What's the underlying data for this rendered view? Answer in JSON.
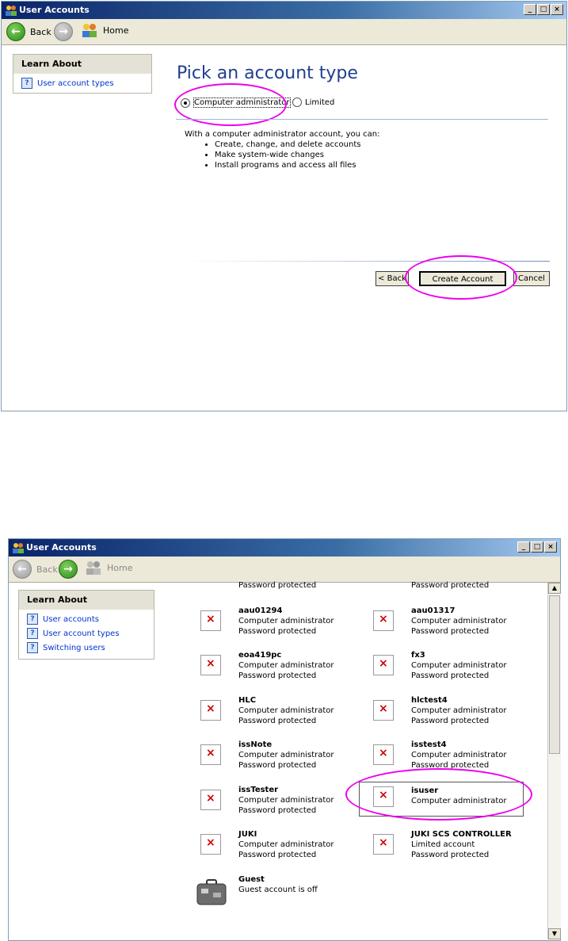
{
  "window1": {
    "title": "User Accounts",
    "back": "Back",
    "home": "Home",
    "learn_about": "Learn About",
    "learn_items": [
      "User account types"
    ],
    "heading": "Pick an account type",
    "radio_admin": "Computer administrator",
    "radio_limited": "Limited",
    "intro": "With a computer administrator account, you can:",
    "bullets": [
      "Create, change, and delete accounts",
      "Make system-wide changes",
      "Install programs and access all files"
    ],
    "back_btn": "< Back",
    "create_btn": "Create Account",
    "cancel_btn": "Cancel"
  },
  "window2": {
    "title": "User Accounts",
    "back": "Back",
    "home": "Home",
    "learn_about": "Learn About",
    "learn_items": [
      "User accounts",
      "User account types",
      "Switching users"
    ],
    "top_partial": [
      "Password protected",
      "Password protected"
    ],
    "accounts": [
      {
        "name": "aau01294",
        "line1": "Computer administrator",
        "line2": "Password protected"
      },
      {
        "name": "aau01317",
        "line1": "Computer administrator",
        "line2": "Password protected"
      },
      {
        "name": "eoa419pc",
        "line1": "Computer administrator",
        "line2": "Password protected"
      },
      {
        "name": "fx3",
        "line1": "Computer administrator",
        "line2": "Password protected"
      },
      {
        "name": "HLC",
        "line1": "Computer administrator",
        "line2": "Password protected"
      },
      {
        "name": "hlctest4",
        "line1": "Computer administrator",
        "line2": "Password protected"
      },
      {
        "name": "issNote",
        "line1": "Computer administrator",
        "line2": "Password protected"
      },
      {
        "name": "isstest4",
        "line1": "Computer administrator",
        "line2": "Password protected"
      },
      {
        "name": "issTester",
        "line1": "Computer administrator",
        "line2": "Password protected"
      },
      {
        "name": "isuser",
        "line1": "Computer administrator",
        "line2": ""
      },
      {
        "name": "JUKI",
        "line1": "Computer administrator",
        "line2": "Password protected"
      },
      {
        "name": "JUKI SCS CONTROLLER",
        "line1": "Limited account",
        "line2": "Password protected"
      },
      {
        "name": "Guest",
        "line1": "Guest account is off",
        "line2": ""
      }
    ]
  }
}
